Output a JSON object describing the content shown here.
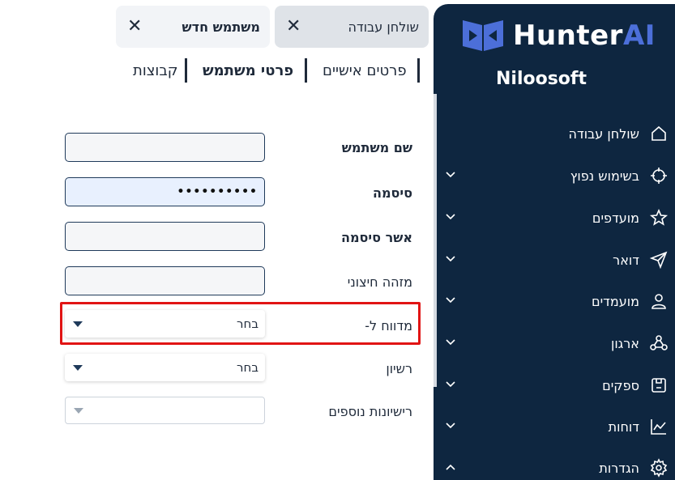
{
  "brand": {
    "name_part1": "Hunter",
    "name_part2": "AI",
    "company": "Niloosoft",
    "accent_color": "#4c6fd9",
    "sidebar_color": "#0e2640"
  },
  "tabs": [
    {
      "label": "שולחן עבודה",
      "close": "✕"
    },
    {
      "label": "משתמש חדש",
      "close": "✕"
    }
  ],
  "subtabs": [
    {
      "label": "פרטים אישיים"
    },
    {
      "label": "פרטי משתמש"
    },
    {
      "label": "קבוצות"
    }
  ],
  "sidebar": {
    "items": [
      {
        "label": "שולחן עבודה",
        "icon": "home-icon",
        "has_chevron": false
      },
      {
        "label": "בשימוש נפוץ",
        "icon": "crosshair-icon",
        "has_chevron": true
      },
      {
        "label": "מועדפים",
        "icon": "star-icon",
        "has_chevron": true
      },
      {
        "label": "דואר",
        "icon": "send-icon",
        "has_chevron": true
      },
      {
        "label": "מועמדים",
        "icon": "user-icon",
        "has_chevron": true
      },
      {
        "label": "ארגון",
        "icon": "organization-icon",
        "has_chevron": true
      },
      {
        "label": "ספקים",
        "icon": "supplier-icon",
        "has_chevron": true
      },
      {
        "label": "דוחות",
        "icon": "chart-icon",
        "has_chevron": true
      },
      {
        "label": "הגדרות",
        "icon": "gear-icon",
        "has_chevron": true,
        "chevron_dir": "up"
      }
    ]
  },
  "form": {
    "username": {
      "label": "שם משתמש",
      "value": ""
    },
    "password": {
      "label": "סיסמה",
      "value": "••••••••••"
    },
    "confirm": {
      "label": "אשר סיסמה",
      "value": ""
    },
    "external_id": {
      "label": "מזהה חיצוני",
      "value": ""
    },
    "reported_to": {
      "label": "מדווח ל-",
      "value": "בחר"
    },
    "license": {
      "label": "רשיון",
      "value": "בחר"
    },
    "extra_licenses": {
      "label": "רישיונות נוספים",
      "value": ""
    }
  }
}
